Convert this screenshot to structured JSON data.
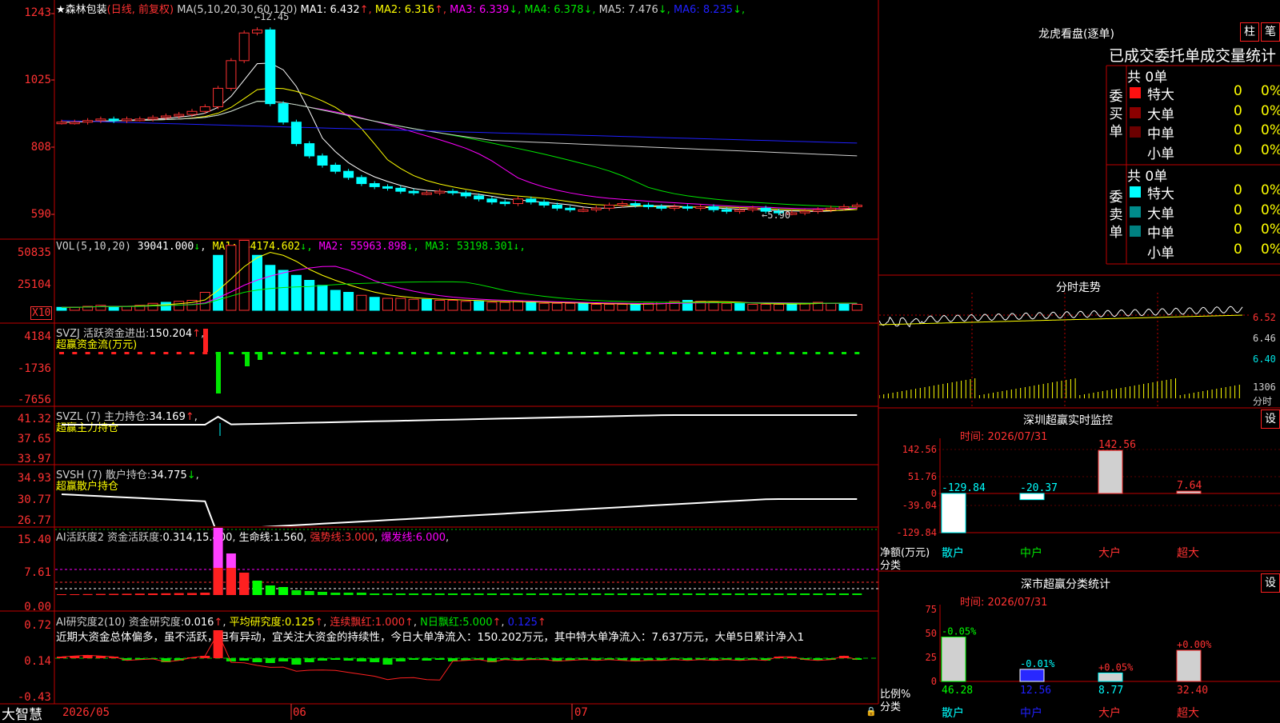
{
  "stock": {
    "star": "★",
    "name": "森林包装",
    "mode": "(日线, 前复权)"
  },
  "ma_header": {
    "ma_label": "MA(5,10,20,30,60,120)",
    "items": [
      {
        "label": "MA1:",
        "value": "6.432",
        "arrow": "↑",
        "color": "#ffffff"
      },
      {
        "label": "MA2:",
        "value": "6.316",
        "arrow": "↑",
        "color": "#ffff00"
      },
      {
        "label": "MA3:",
        "value": "6.339",
        "arrow": "↓",
        "color": "#ff00ff"
      },
      {
        "label": "MA4:",
        "value": "6.378",
        "arrow": "↓",
        "color": "#00e600"
      },
      {
        "label": "MA5:",
        "value": "7.476",
        "arrow": "↓",
        "color": "#cfcfcf"
      },
      {
        "label": "MA6:",
        "value": "8.235",
        "arrow": "↓",
        "color": "#2020ff"
      }
    ]
  },
  "price_axis": [
    "1243",
    "1025",
    "808",
    "590"
  ],
  "price_marks": {
    "high": "12.45",
    "low": "5.90"
  },
  "vol": {
    "header": "VOL(5,10,20)",
    "value": "39041.000",
    "arrow": "↓",
    "items": [
      {
        "label": "MA1:",
        "value": "44174.602",
        "arrow": "↓"
      },
      {
        "label": "MA2:",
        "value": "55963.898",
        "arrow": "↓"
      },
      {
        "label": "MA3:",
        "value": "53198.301",
        "arrow": "↓"
      }
    ],
    "axis": [
      "50835",
      "25104"
    ],
    "unit": "X10"
  },
  "svzj": {
    "header": "SVZJ  活跃资金进出:",
    "value": "150.204",
    "arrow": "↑",
    "sub": "超赢资金流(万元)",
    "axis": [
      "4184",
      "-1736",
      "-7656"
    ]
  },
  "svzl": {
    "header": "SVZL (7) 主力持仓:",
    "value": "34.169",
    "arrow": "↑",
    "sub": "超赢主力持仓",
    "axis": [
      "41.32",
      "37.65",
      "33.97"
    ]
  },
  "svsh": {
    "header": "SVSH (7) 散户持仓:",
    "value": "34.775",
    "arrow": "↓",
    "sub": "超赢散户持仓",
    "axis": [
      "34.93",
      "30.77",
      "26.77"
    ]
  },
  "ai1": {
    "header": "AI活跃度2 资金活跃度:",
    "value": "0.314",
    "v2": "15.400",
    "life": "生命线:",
    "life_v": "1.560",
    "strong": "强势线:",
    "strong_v": "3.000",
    "burst": "爆发线:",
    "burst_v": "6.000",
    "axis": [
      "15.40",
      "7.61",
      "0.00"
    ]
  },
  "ai2": {
    "header": "AI研究度2(10) 资金研究度:",
    "value": "0.016",
    "avg": "平均研究度:",
    "avg_v": "0.125",
    "cont": "连续飘红:",
    "cont_v": "1.000",
    "nday": "N日飘红:",
    "nday_v": "5.000",
    "last": "0.125",
    "text": "近期大资金总体偏多，虽不活跃，但有异动，宜关注大资金的持续性，今日大单净流入：150.202万元，其中特大单净流入：7.637万元，大单5日累计净入1",
    "axis": [
      "0.72",
      "0.14",
      "-0.43"
    ]
  },
  "bottom": {
    "logo": "大智慧",
    "dates": [
      "2026/05",
      "06",
      "07"
    ]
  },
  "right": {
    "lhkp_title": "龙虎看盘(逐单)",
    "btn_zhu": "柱",
    "btn_bi": "笔",
    "stat_title": "已成交委托单成交量统计",
    "buy_side": "委买单",
    "sell_side": "委卖单",
    "buy_total": "共 0单",
    "sell_total": "共 0单",
    "buy_rows": [
      {
        "name": "特大",
        "v": "0",
        "p": "0%",
        "c": "#ff1010"
      },
      {
        "name": "大单",
        "v": "0",
        "p": "0%",
        "c": "#8b0000"
      },
      {
        "name": "中单",
        "v": "0",
        "p": "0%",
        "c": "#6b0000"
      },
      {
        "name": "小单",
        "v": "0",
        "p": "0%",
        "c": ""
      }
    ],
    "sell_rows": [
      {
        "name": "特大",
        "v": "0",
        "p": "0%",
        "c": "#00ffff"
      },
      {
        "name": "大单",
        "v": "0",
        "p": "0%",
        "c": "#008b8b"
      },
      {
        "name": "中单",
        "v": "0",
        "p": "0%",
        "c": "#008080"
      },
      {
        "name": "小单",
        "v": "0",
        "p": "0%",
        "c": ""
      }
    ],
    "fenshi_title": "分时走势",
    "fenshi_axis": [
      "6.52",
      "6.46",
      "6.40"
    ],
    "fenshi_vol": "1306",
    "fenshi_unit": "分时",
    "monitor_title": "深圳超赢实时监控",
    "monitor_btn": "设",
    "monitor_time": "时间: 2026/07/31",
    "monitor_axis": [
      "142.56",
      "51.76",
      "0",
      "-39.04",
      "-129.84"
    ],
    "net_label": "净额(万元)",
    "cls_label": "分类",
    "cats": [
      "散户",
      "中户",
      "大户",
      "超大"
    ],
    "net_values": [
      "-129.84",
      "-20.37",
      "142.56",
      "7.64"
    ],
    "stat2_title": "深市超赢分类统计",
    "stat2_btn": "设",
    "stat2_time": "时间: 2026/07/31",
    "stat2_axis": [
      "75",
      "50",
      "25",
      "0"
    ],
    "ratio_label": "比例%",
    "ratio_top": [
      "-0.05%",
      "-0.01%",
      "+0.05%",
      "+0.00%"
    ],
    "ratio_vals": [
      "46.28",
      "12.56",
      "8.77",
      "32.40"
    ]
  },
  "chart_data": {
    "type": "bar",
    "title": "深圳超赢实时监控",
    "categories": [
      "散户",
      "中户",
      "大户",
      "超大"
    ],
    "series": [
      {
        "values": [
          -129.84,
          -20.37,
          142.56,
          7.64
        ]
      }
    ]
  }
}
